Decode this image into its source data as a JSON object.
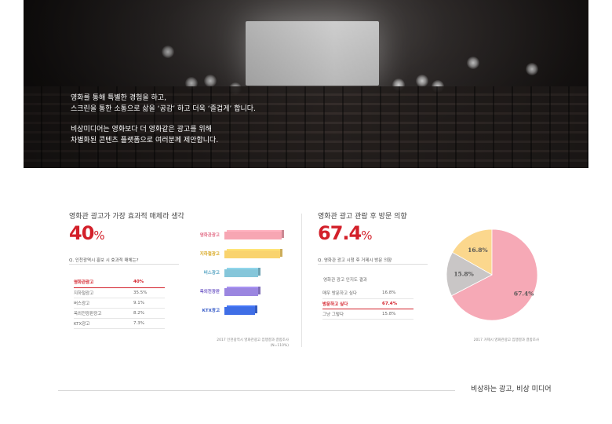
{
  "hero": {
    "line1": "영화를 통해 특별한 경험을 하고,",
    "line2": "스크린을 통한 소통으로 삶을 ‘공감’ 하고 더욱 ‘즐겁게’ 합니다.",
    "line3": "비상미디어는 영화보다 더 영화같은 광고를 위해",
    "line4": "차별화된 콘텐츠 플랫폼으로 여러분께 제안합니다."
  },
  "left": {
    "title": "영화관 광고가 가장 효과적 매체라 생각",
    "big_value": "40",
    "big_unit": "%",
    "question": "Q. 인천광역시 홍보 시 효과적 매체는?",
    "rows": [
      {
        "label": "영화관광고",
        "value": "40%",
        "highlight": true
      },
      {
        "label": "지하철광고",
        "value": "35.5%",
        "highlight": false
      },
      {
        "label": "버스광고",
        "value": "9.1%",
        "highlight": false
      },
      {
        "label": "옥외전광판광고",
        "value": "8.2%",
        "highlight": false
      },
      {
        "label": "KTX광고",
        "value": "7.3%",
        "highlight": false
      }
    ],
    "source_line1": "2017 인천광역시 영화관광고 집행결과 결합조사",
    "source_line2": "(N=110%)"
  },
  "left_chart": {
    "type": "bar",
    "orientation": "horizontal",
    "categories": [
      "영화관광고",
      "지하철광고",
      "버스광고",
      "옥외전광판",
      "KTX광고"
    ],
    "values": [
      40,
      35.5,
      9.1,
      8.2,
      7.3
    ],
    "colors": [
      "#f7a6b3",
      "#f9d36e",
      "#85c6da",
      "#9b86e0",
      "#3f6ee6"
    ],
    "label_colors": [
      "#e26d86",
      "#d8a924",
      "#5aa6c4",
      "#7660c8",
      "#3358c7"
    ]
  },
  "right": {
    "title": "영화관 광고 관람 후 방문 의향",
    "big_value": "67.4",
    "big_unit": "%",
    "question": "Q. 영화관 광고 시청 후 거제시 방문 의향",
    "subhead": "영화관 광고 인지도 결과",
    "rows": [
      {
        "label": "매우 방문하고 싶다",
        "value": "16.8%",
        "highlight": false
      },
      {
        "label": "방문하고 싶다",
        "value": "67.4%",
        "highlight": true
      },
      {
        "label": "그냥 그렇다",
        "value": "15.8%",
        "highlight": false
      }
    ],
    "source_line1": "2017 거제시 영화관광고 집행결과 결합조사"
  },
  "chart_data": {
    "type": "pie",
    "categories": [
      "매우 방문하고 싶다",
      "방문하고 싶다",
      "그냥 그렇다"
    ],
    "values": [
      16.8,
      67.4,
      15.8
    ],
    "labels": [
      "16.8%",
      "67.4%",
      "15.8%"
    ],
    "colors": [
      "#fbd78d",
      "#f6a9b6",
      "#c9c6c6"
    ]
  },
  "footer": {
    "tagline": "비상하는 광고, 비상 미디어"
  }
}
